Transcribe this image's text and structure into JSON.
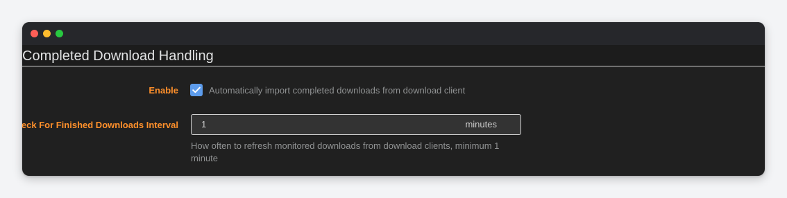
{
  "section": {
    "title": "Completed Download Handling"
  },
  "enable": {
    "label": "Enable",
    "checked": true,
    "description": "Automatically import completed downloads from download client"
  },
  "interval": {
    "label": "Check For Finished Downloads Interval",
    "value": "1",
    "unit": "minutes",
    "help": "How often to refresh monitored downloads from download clients, minimum 1 minute"
  },
  "colors": {
    "label_accent": "#ff902b",
    "checkbox": "#5d9cec",
    "panel": "#202020",
    "page_background": "#f3f4f6"
  },
  "icons": {
    "checkbox_mark": "checkmark-icon"
  }
}
